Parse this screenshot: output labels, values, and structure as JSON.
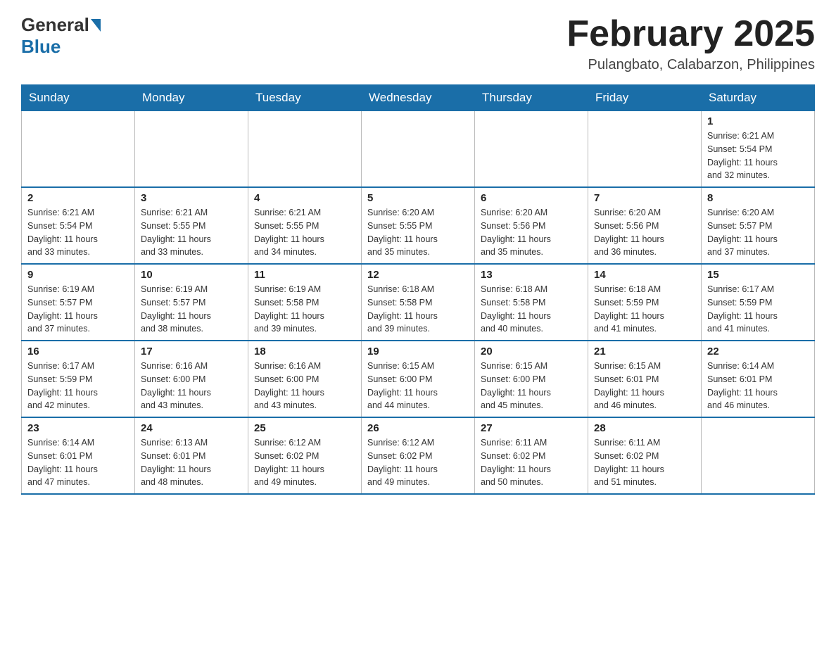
{
  "header": {
    "logo_general": "General",
    "logo_blue": "Blue",
    "title": "February 2025",
    "subtitle": "Pulangbato, Calabarzon, Philippines"
  },
  "weekdays": [
    "Sunday",
    "Monday",
    "Tuesday",
    "Wednesday",
    "Thursday",
    "Friday",
    "Saturday"
  ],
  "weeks": [
    [
      {
        "day": "",
        "info": ""
      },
      {
        "day": "",
        "info": ""
      },
      {
        "day": "",
        "info": ""
      },
      {
        "day": "",
        "info": ""
      },
      {
        "day": "",
        "info": ""
      },
      {
        "day": "",
        "info": ""
      },
      {
        "day": "1",
        "info": "Sunrise: 6:21 AM\nSunset: 5:54 PM\nDaylight: 11 hours\nand 32 minutes."
      }
    ],
    [
      {
        "day": "2",
        "info": "Sunrise: 6:21 AM\nSunset: 5:54 PM\nDaylight: 11 hours\nand 33 minutes."
      },
      {
        "day": "3",
        "info": "Sunrise: 6:21 AM\nSunset: 5:55 PM\nDaylight: 11 hours\nand 33 minutes."
      },
      {
        "day": "4",
        "info": "Sunrise: 6:21 AM\nSunset: 5:55 PM\nDaylight: 11 hours\nand 34 minutes."
      },
      {
        "day": "5",
        "info": "Sunrise: 6:20 AM\nSunset: 5:55 PM\nDaylight: 11 hours\nand 35 minutes."
      },
      {
        "day": "6",
        "info": "Sunrise: 6:20 AM\nSunset: 5:56 PM\nDaylight: 11 hours\nand 35 minutes."
      },
      {
        "day": "7",
        "info": "Sunrise: 6:20 AM\nSunset: 5:56 PM\nDaylight: 11 hours\nand 36 minutes."
      },
      {
        "day": "8",
        "info": "Sunrise: 6:20 AM\nSunset: 5:57 PM\nDaylight: 11 hours\nand 37 minutes."
      }
    ],
    [
      {
        "day": "9",
        "info": "Sunrise: 6:19 AM\nSunset: 5:57 PM\nDaylight: 11 hours\nand 37 minutes."
      },
      {
        "day": "10",
        "info": "Sunrise: 6:19 AM\nSunset: 5:57 PM\nDaylight: 11 hours\nand 38 minutes."
      },
      {
        "day": "11",
        "info": "Sunrise: 6:19 AM\nSunset: 5:58 PM\nDaylight: 11 hours\nand 39 minutes."
      },
      {
        "day": "12",
        "info": "Sunrise: 6:18 AM\nSunset: 5:58 PM\nDaylight: 11 hours\nand 39 minutes."
      },
      {
        "day": "13",
        "info": "Sunrise: 6:18 AM\nSunset: 5:58 PM\nDaylight: 11 hours\nand 40 minutes."
      },
      {
        "day": "14",
        "info": "Sunrise: 6:18 AM\nSunset: 5:59 PM\nDaylight: 11 hours\nand 41 minutes."
      },
      {
        "day": "15",
        "info": "Sunrise: 6:17 AM\nSunset: 5:59 PM\nDaylight: 11 hours\nand 41 minutes."
      }
    ],
    [
      {
        "day": "16",
        "info": "Sunrise: 6:17 AM\nSunset: 5:59 PM\nDaylight: 11 hours\nand 42 minutes."
      },
      {
        "day": "17",
        "info": "Sunrise: 6:16 AM\nSunset: 6:00 PM\nDaylight: 11 hours\nand 43 minutes."
      },
      {
        "day": "18",
        "info": "Sunrise: 6:16 AM\nSunset: 6:00 PM\nDaylight: 11 hours\nand 43 minutes."
      },
      {
        "day": "19",
        "info": "Sunrise: 6:15 AM\nSunset: 6:00 PM\nDaylight: 11 hours\nand 44 minutes."
      },
      {
        "day": "20",
        "info": "Sunrise: 6:15 AM\nSunset: 6:00 PM\nDaylight: 11 hours\nand 45 minutes."
      },
      {
        "day": "21",
        "info": "Sunrise: 6:15 AM\nSunset: 6:01 PM\nDaylight: 11 hours\nand 46 minutes."
      },
      {
        "day": "22",
        "info": "Sunrise: 6:14 AM\nSunset: 6:01 PM\nDaylight: 11 hours\nand 46 minutes."
      }
    ],
    [
      {
        "day": "23",
        "info": "Sunrise: 6:14 AM\nSunset: 6:01 PM\nDaylight: 11 hours\nand 47 minutes."
      },
      {
        "day": "24",
        "info": "Sunrise: 6:13 AM\nSunset: 6:01 PM\nDaylight: 11 hours\nand 48 minutes."
      },
      {
        "day": "25",
        "info": "Sunrise: 6:12 AM\nSunset: 6:02 PM\nDaylight: 11 hours\nand 49 minutes."
      },
      {
        "day": "26",
        "info": "Sunrise: 6:12 AM\nSunset: 6:02 PM\nDaylight: 11 hours\nand 49 minutes."
      },
      {
        "day": "27",
        "info": "Sunrise: 6:11 AM\nSunset: 6:02 PM\nDaylight: 11 hours\nand 50 minutes."
      },
      {
        "day": "28",
        "info": "Sunrise: 6:11 AM\nSunset: 6:02 PM\nDaylight: 11 hours\nand 51 minutes."
      },
      {
        "day": "",
        "info": ""
      }
    ]
  ]
}
